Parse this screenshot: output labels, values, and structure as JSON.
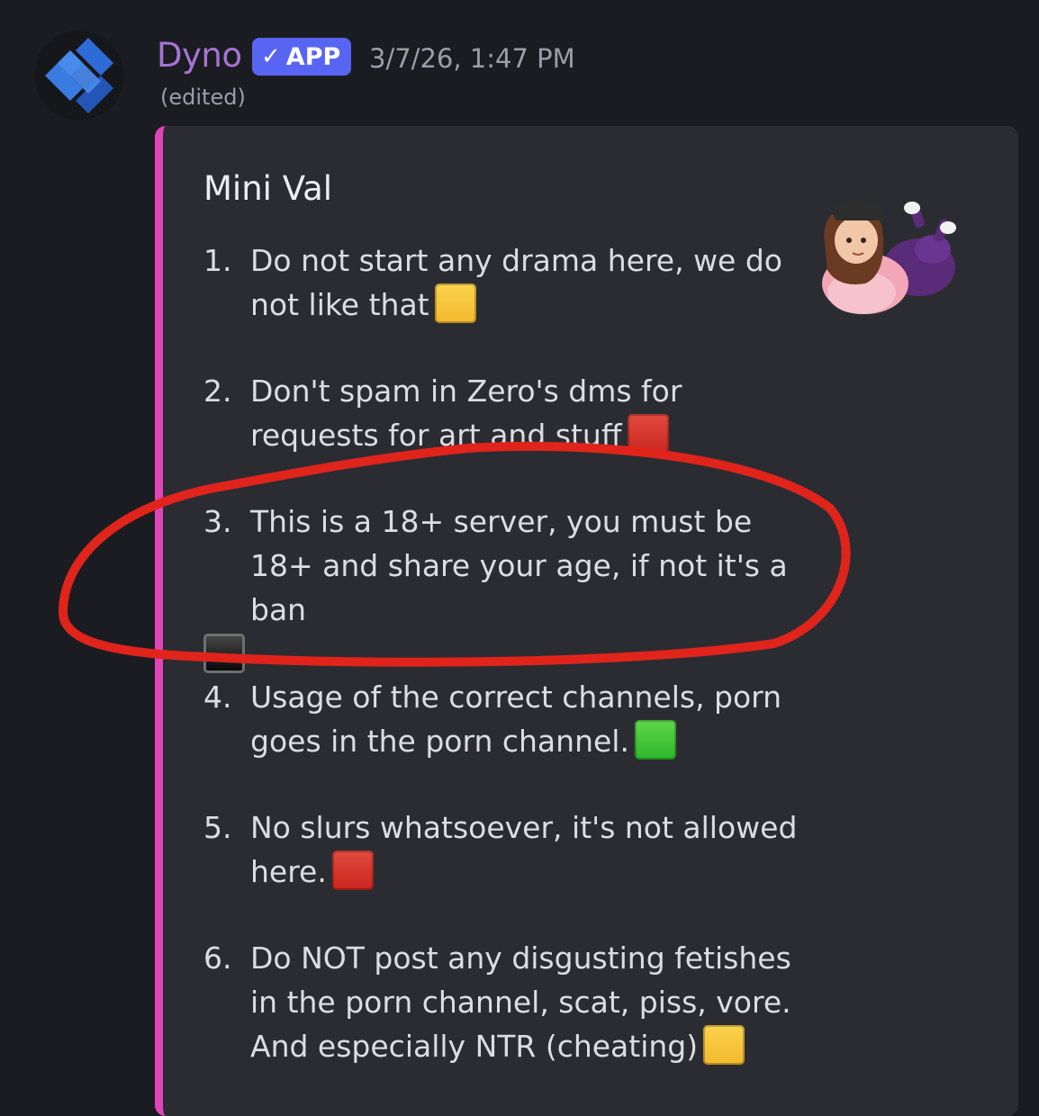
{
  "message": {
    "author": "Dyno",
    "badge": "APP",
    "badge_icon": "checkmark-icon",
    "timestamp": "3/7/26, 1:47 PM",
    "edited": "(edited)",
    "avatar_icon": "dyno-logo-icon"
  },
  "embed": {
    "accent_color": "#e044b8",
    "title": "Mini Val",
    "thumbnail": "cartoon-girl-sticker",
    "rules": [
      {
        "num": "1.",
        "text": "Do not start any drama here, we do not like that",
        "emoji": "yellow-square"
      },
      {
        "num": "2.",
        "text": "Don't spam in Zero's dms for requests for art and stuff",
        "emoji": "red-square"
      },
      {
        "num": "3.",
        "text": "This is a 18+ server, you must be 18+ and share your age, if not it's a ban",
        "emoji": "black-square"
      },
      {
        "num": "4.",
        "text": "Usage of the correct channels, porn goes in the porn channel.",
        "emoji": "green-square"
      },
      {
        "num": "5.",
        "text": "No slurs whatsoever, it's not allowed here.",
        "emoji": "red-square"
      },
      {
        "num": "6.",
        "text": "Do NOT post any disgusting fetishes in the porn channel, scat, piss, vore. And especially NTR (cheating)",
        "emoji": "yellow-square"
      }
    ]
  },
  "annotation": {
    "shape": "hand-drawn-circle",
    "color": "#e0241b",
    "target": "rule 3"
  }
}
